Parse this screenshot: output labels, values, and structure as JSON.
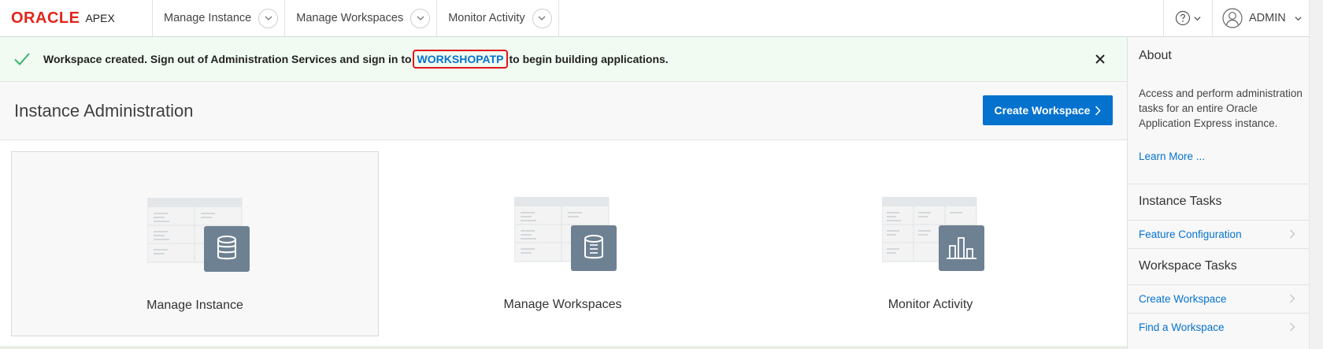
{
  "nav": {
    "brand_oracle": "ORACLE",
    "brand_apex": "APEX",
    "menus": [
      "Manage Instance",
      "Manage Workspaces",
      "Monitor Activity"
    ],
    "user": "ADMIN"
  },
  "alert": {
    "text_before": "Workspace created. Sign out of Administration Services and sign in to",
    "workspace": "WORKSHOPATP",
    "text_after": "to begin building applications."
  },
  "page": {
    "title": "Instance Administration",
    "create_button": "Create Workspace"
  },
  "cards": [
    {
      "label": "Manage Instance",
      "icon": "database-icon",
      "selected": true
    },
    {
      "label": "Manage Workspaces",
      "icon": "database-icon",
      "selected": false
    },
    {
      "label": "Monitor Activity",
      "icon": "bar-chart-icon",
      "selected": false
    }
  ],
  "sidebar": {
    "about_title": "About",
    "about_text": "Access and perform administration tasks for an entire Oracle Application Express instance.",
    "learn_more": "Learn More ...",
    "instance_tasks_title": "Instance Tasks",
    "instance_tasks": [
      "Feature Configuration"
    ],
    "workspace_tasks_title": "Workspace Tasks",
    "workspace_tasks": [
      "Create Workspace",
      "Find a Workspace"
    ]
  },
  "colors": {
    "brand_red": "#e1251b",
    "primary_blue": "#0572ce",
    "success_green": "#3cb371",
    "icon_slate": "#6e8193",
    "highlight_red": "#e3151b"
  }
}
